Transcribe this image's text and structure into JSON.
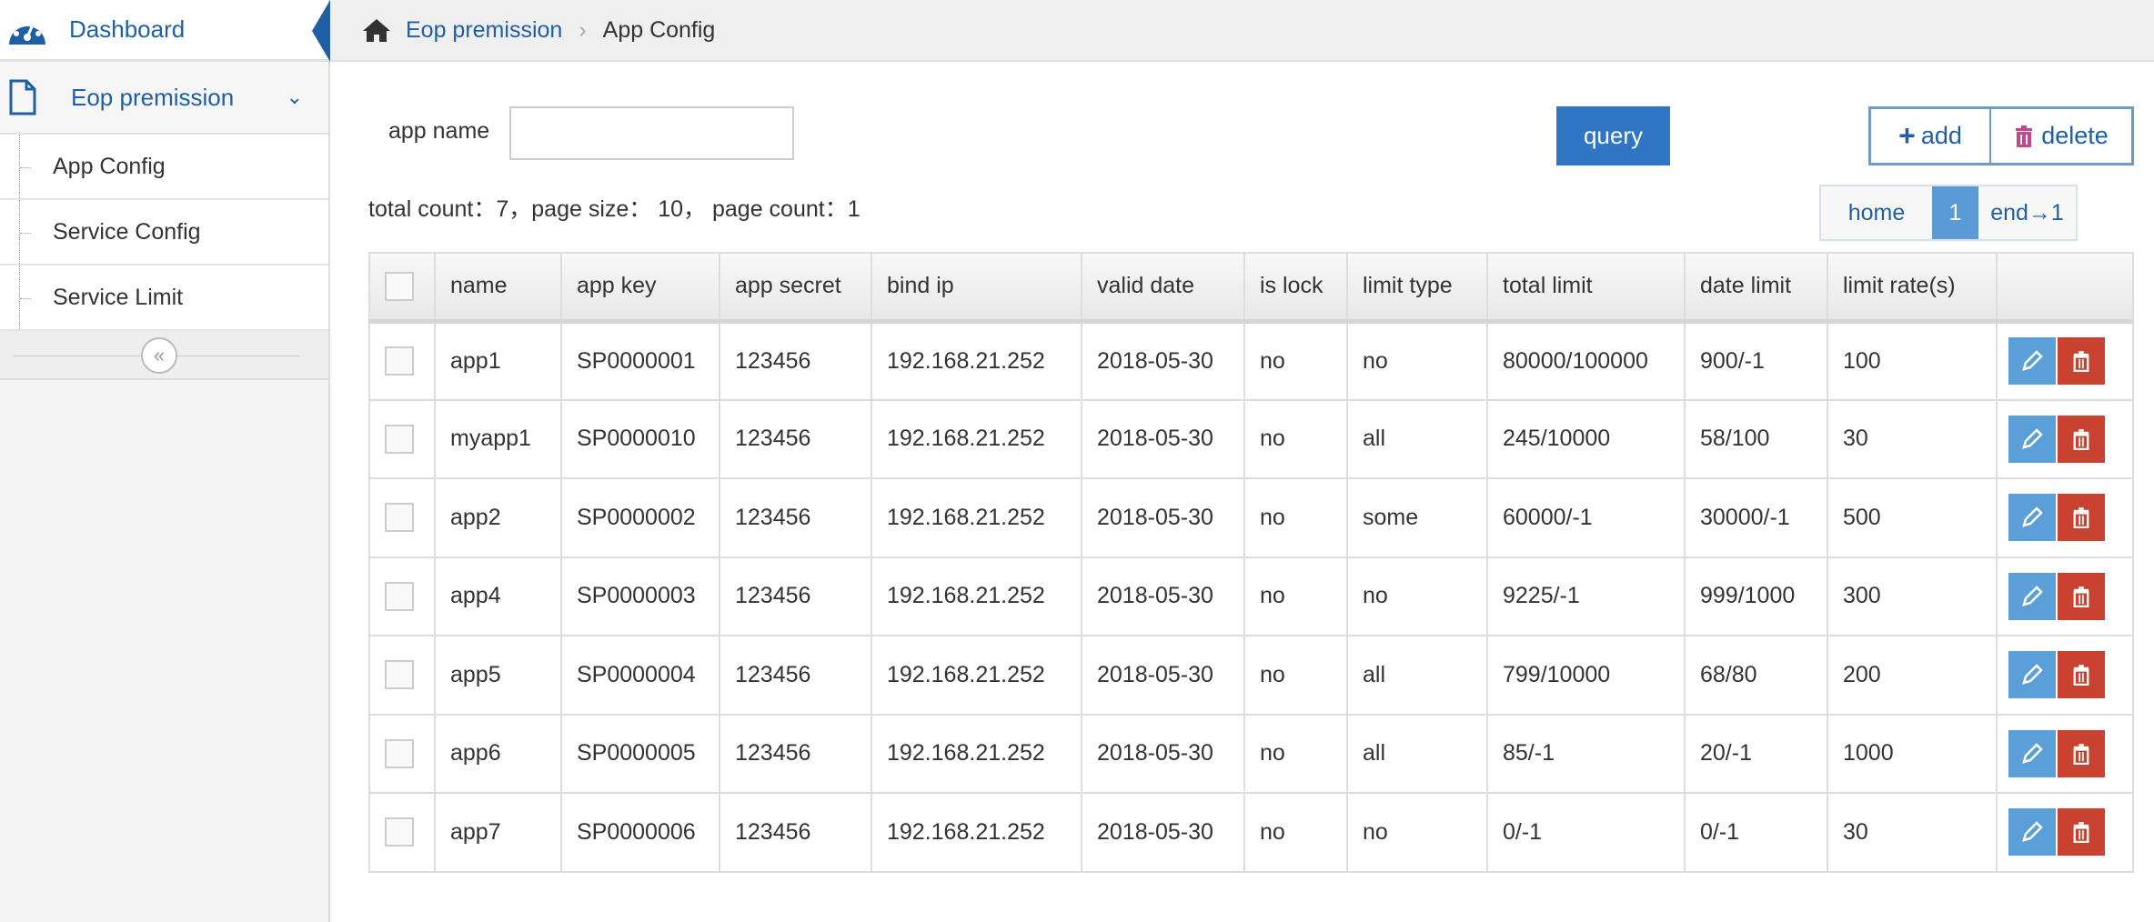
{
  "sidebar": {
    "dashboard": "Dashboard",
    "group": "Eop premission",
    "items": [
      {
        "label": "App Config"
      },
      {
        "label": "Service Config"
      },
      {
        "label": "Service Limit"
      }
    ],
    "collapse": "«"
  },
  "breadcrumb": {
    "parent": "Eop premission",
    "current": "App Config",
    "separator": "›"
  },
  "search": {
    "label": "app name",
    "value": "",
    "placeholder": ""
  },
  "buttons": {
    "query": "query",
    "add": "add",
    "delete": "delete"
  },
  "stats": "total count：7，page size： 10， page count：1",
  "pager": {
    "home": "home",
    "current": "1",
    "end": "end→1"
  },
  "colors": {
    "primary": "#2f76c5",
    "edit": "#5b9fd8",
    "delete": "#c9422f"
  },
  "table": {
    "headers": [
      "name",
      "app key",
      "app secret",
      "bind ip",
      "valid date",
      "is lock",
      "limit type",
      "total limit",
      "date limit",
      "limit rate(s)"
    ],
    "rows": [
      [
        "app1",
        "SP0000001",
        "123456",
        "192.168.21.252",
        "2018-05-30",
        "no",
        "no",
        "80000/100000",
        "900/-1",
        "100"
      ],
      [
        "myapp1",
        "SP0000010",
        "123456",
        "192.168.21.252",
        "2018-05-30",
        "no",
        "all",
        "245/10000",
        "58/100",
        "30"
      ],
      [
        "app2",
        "SP0000002",
        "123456",
        "192.168.21.252",
        "2018-05-30",
        "no",
        "some",
        "60000/-1",
        "30000/-1",
        "500"
      ],
      [
        "app4",
        "SP0000003",
        "123456",
        "192.168.21.252",
        "2018-05-30",
        "no",
        "no",
        "9225/-1",
        "999/1000",
        "300"
      ],
      [
        "app5",
        "SP0000004",
        "123456",
        "192.168.21.252",
        "2018-05-30",
        "no",
        "all",
        "799/10000",
        "68/80",
        "200"
      ],
      [
        "app6",
        "SP0000005",
        "123456",
        "192.168.21.252",
        "2018-05-30",
        "no",
        "all",
        "85/-1",
        "20/-1",
        "1000"
      ],
      [
        "app7",
        "SP0000006",
        "123456",
        "192.168.21.252",
        "2018-05-30",
        "no",
        "no",
        "0/-1",
        "0/-1",
        "30"
      ]
    ]
  }
}
